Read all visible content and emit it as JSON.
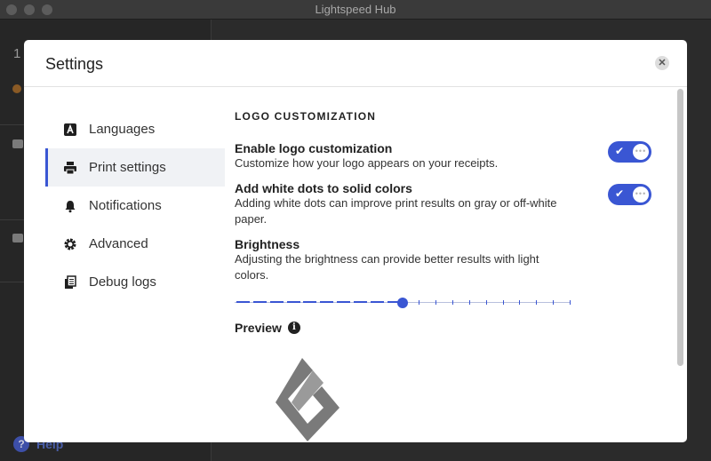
{
  "window": {
    "title": "Lightspeed Hub"
  },
  "background": {
    "counter": "1",
    "help_label": "Help"
  },
  "modal": {
    "title": "Settings",
    "close_glyph": "✕"
  },
  "nav": {
    "items": [
      {
        "label": "Languages",
        "icon": "languages-icon",
        "active": false
      },
      {
        "label": "Print settings",
        "icon": "printer-icon",
        "active": true
      },
      {
        "label": "Notifications",
        "icon": "bell-icon",
        "active": false
      },
      {
        "label": "Advanced",
        "icon": "gear-icon",
        "active": false
      },
      {
        "label": "Debug logs",
        "icon": "logs-icon",
        "active": false
      }
    ]
  },
  "content": {
    "section_title": "LOGO CUSTOMIZATION",
    "enable_logo": {
      "title": "Enable logo customization",
      "description": "Customize how your logo appears on your receipts.",
      "enabled": true
    },
    "white_dots": {
      "title": "Add white dots to solid colors",
      "description": "Adding white dots can improve print results on gray or off-white paper.",
      "enabled": true
    },
    "brightness": {
      "title": "Brightness",
      "description": "Adjusting the brightness can provide better results with light colors.",
      "steps": 20,
      "value": 10
    },
    "preview": {
      "label": "Preview",
      "info_glyph": "i"
    }
  },
  "colors": {
    "accent": "#3a56d3",
    "logo": "#7a7a7a"
  }
}
